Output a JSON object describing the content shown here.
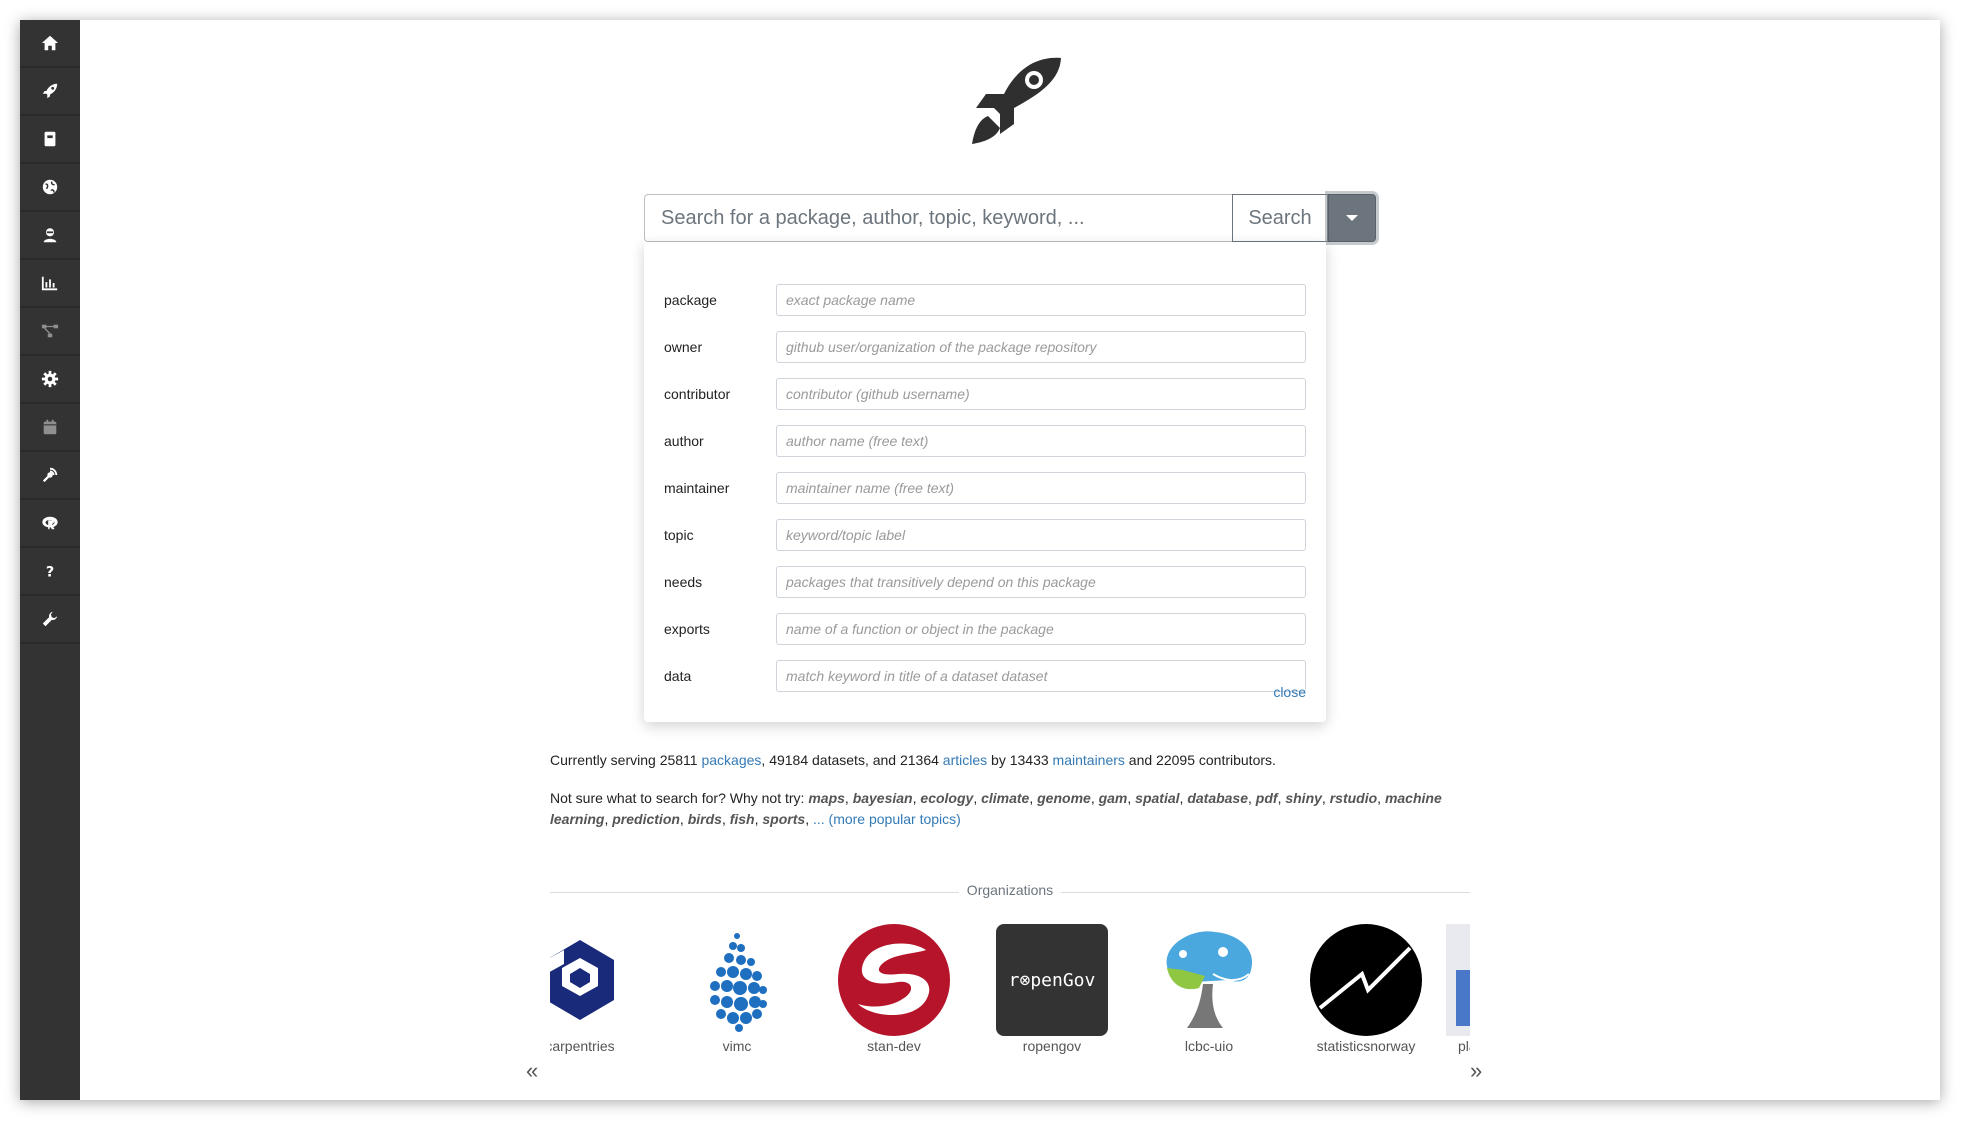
{
  "sidebar": {
    "items": [
      {
        "icon": "home-icon"
      },
      {
        "icon": "rocket-icon"
      },
      {
        "icon": "book-icon"
      },
      {
        "icon": "globe-icon"
      },
      {
        "icon": "user-secret-icon"
      },
      {
        "icon": "bar-chart-icon"
      },
      {
        "icon": "network-icon"
      },
      {
        "icon": "gear-icon"
      },
      {
        "icon": "calendar-icon"
      },
      {
        "icon": "satellite-dish-icon"
      },
      {
        "icon": "r-logo-icon"
      },
      {
        "icon": "question-icon"
      },
      {
        "icon": "wrench-icon"
      }
    ]
  },
  "search": {
    "placeholder": "Search for a package, author, topic, keyword, ...",
    "button_label": "Search"
  },
  "advanced": {
    "fields": [
      {
        "label": "package",
        "placeholder": "exact package name"
      },
      {
        "label": "owner",
        "placeholder": "github user/organization of the package repository"
      },
      {
        "label": "contributor",
        "placeholder": "contributor (github username)"
      },
      {
        "label": "author",
        "placeholder": "author name (free text)"
      },
      {
        "label": "maintainer",
        "placeholder": "maintainer name (free text)"
      },
      {
        "label": "topic",
        "placeholder": "keyword/topic label"
      },
      {
        "label": "needs",
        "placeholder": "packages that transitively depend on this package"
      },
      {
        "label": "exports",
        "placeholder": "name of a function or object in the package"
      },
      {
        "label": "data",
        "placeholder": "match keyword in title of a dataset dataset"
      }
    ],
    "close_label": "close"
  },
  "stats": {
    "prefix": "Currently serving 25811 ",
    "packages_link": "packages",
    "middle1": ", 49184 datasets, and 21364 ",
    "articles_link": "articles",
    "middle2": " by 13433 ",
    "maintainers_link": "maintainers",
    "suffix": " and 22095 contributors."
  },
  "suggest": {
    "prefix": "Not sure what to search for? Why not try: ",
    "topics": [
      "maps",
      "bayesian",
      "ecology",
      "climate",
      "genome",
      "gam",
      "spatial",
      "database",
      "pdf",
      "shiny",
      "rstudio",
      "machine learning",
      "prediction",
      "birds",
      "fish",
      "sports"
    ],
    "more_link": "... (more popular topics)"
  },
  "organizations": {
    "title": "Organizations",
    "items": [
      {
        "name": "carpentries",
        "color": "#1a2a7a"
      },
      {
        "name": "vimc",
        "color": "#1e6fc0"
      },
      {
        "name": "stan-dev",
        "color": "#b5142a"
      },
      {
        "name": "ropengov",
        "color": "#333333",
        "logo_text": "r⊗penGov"
      },
      {
        "name": "lcbc-uio",
        "color": "#4aa8de"
      },
      {
        "name": "statisticsnorway",
        "color": "#000000"
      },
      {
        "name": "pla",
        "color": "#4a78c8"
      }
    ],
    "prev_label": "«",
    "next_label": "»"
  }
}
